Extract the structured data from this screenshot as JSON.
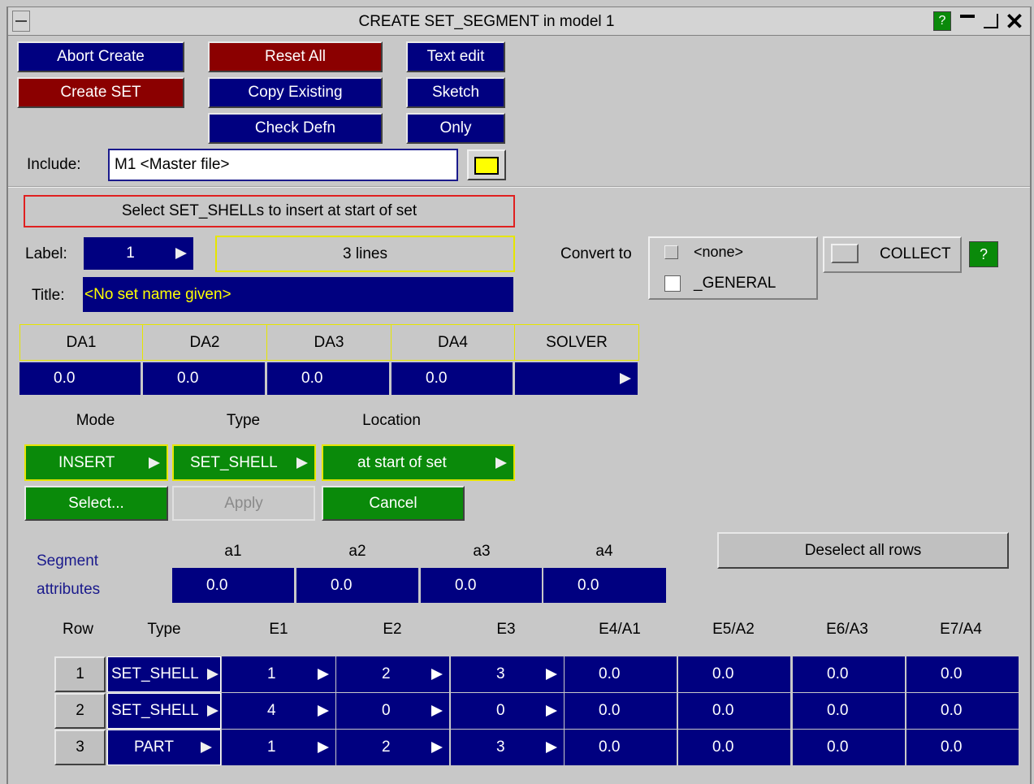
{
  "window": {
    "title": "CREATE SET_SEGMENT in model 1",
    "help": "?"
  },
  "toolbar": {
    "abort_create": "Abort Create",
    "reset_all": "Reset All",
    "text_edit": "Text edit",
    "create_set": "Create SET",
    "copy_existing": "Copy Existing",
    "sketch": "Sketch",
    "check_defn": "Check Defn",
    "only": "Only"
  },
  "include": {
    "label": "Include:",
    "value": "M1  <Master file>"
  },
  "message": "Select SET_SHELLs to insert at start of set",
  "label_field": {
    "label": "Label:",
    "value": "1",
    "lines": "3 lines"
  },
  "title_field": {
    "label": "Title:",
    "value": "<No set name given>"
  },
  "convert": {
    "label": "Convert to",
    "opt1": "<none>",
    "opt2": "_GENERAL",
    "collect": "COLLECT",
    "help": "?"
  },
  "da": {
    "headers": [
      "DA1",
      "DA2",
      "DA3",
      "DA4",
      "SOLVER"
    ],
    "values": [
      "0.0",
      "0.0",
      "0.0",
      "0.0",
      ""
    ]
  },
  "mode_row": {
    "mode_label": "Mode",
    "type_label": "Type",
    "location_label": "Location",
    "mode": "INSERT",
    "type": "SET_SHELL",
    "location": "at start of set",
    "select": "Select...",
    "apply": "Apply",
    "cancel": "Cancel"
  },
  "segment": {
    "label1": "Segment",
    "label2": "attributes",
    "headers": [
      "a1",
      "a2",
      "a3",
      "a4"
    ],
    "values": [
      "0.0",
      "0.0",
      "0.0",
      "0.0"
    ],
    "deselect": "Deselect all rows"
  },
  "table": {
    "headers": [
      "Row",
      "Type",
      "E1",
      "E2",
      "E3",
      "E4/A1",
      "E5/A2",
      "E6/A3",
      "E7/A4"
    ],
    "rows": [
      {
        "row": "1",
        "type": "SET_SHELL",
        "e1": "1",
        "e2": "2",
        "e3": "3",
        "e4": "0.0",
        "e5": "0.0",
        "e6": "0.0",
        "e7": "0.0"
      },
      {
        "row": "2",
        "type": "SET_SHELL",
        "e1": "4",
        "e2": "0",
        "e3": "0",
        "e4": "0.0",
        "e5": "0.0",
        "e6": "0.0",
        "e7": "0.0"
      },
      {
        "row": "3",
        "type": "PART",
        "e1": "1",
        "e2": "2",
        "e3": "3",
        "e4": "0.0",
        "e5": "0.0",
        "e6": "0.0",
        "e7": "0.0"
      }
    ]
  },
  "colors": {
    "navy": "#000080",
    "dark_red": "#8b0000",
    "green": "#0a8a0a",
    "panel": "#c8c8c8",
    "yellow_border": "#e6e600"
  }
}
